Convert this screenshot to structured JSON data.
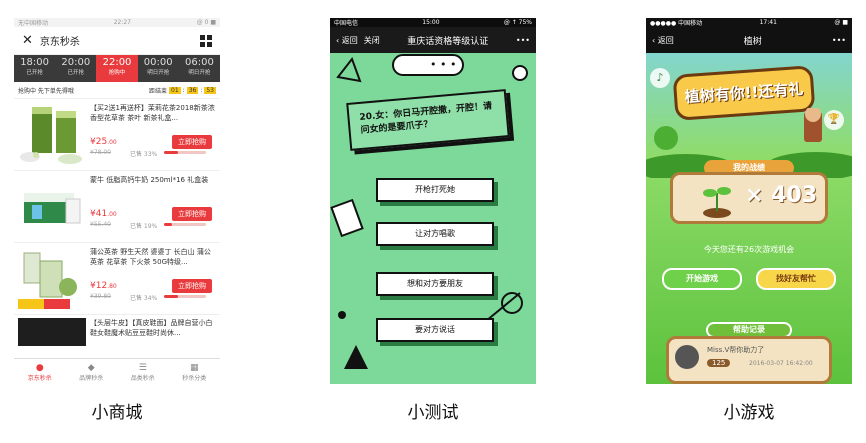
{
  "captions": [
    "小商城",
    "小测试",
    "小游戏"
  ],
  "shop": {
    "status_left": "无中国移动 ",
    "status_time": "22:27",
    "status_right": "@ 0 ■",
    "title": "京东秒杀",
    "time_slots": [
      {
        "time": "18:00",
        "status": "已开抢"
      },
      {
        "time": "20:00",
        "status": "已开抢"
      },
      {
        "time": "22:00",
        "status": "抢购中"
      },
      {
        "time": "00:00",
        "status": "明日开抢"
      },
      {
        "time": "06:00",
        "status": "明日开抢"
      }
    ],
    "subbar_left": "抢购中 先下单先得哦",
    "countdown_label": "距结束",
    "countdown": [
      "01",
      "36",
      "53"
    ],
    "products": [
      {
        "title": "【买2送1再送杯】茉莉花茶2018新茶浓香型花草茶 茶叶 新茶礼盒...",
        "price": "25",
        "price_dec": ".00",
        "old": "¥78.00",
        "sold": "已售 33%",
        "sold_pct": 33,
        "button": "立即抢购"
      },
      {
        "title": "蒙牛 低脂高钙牛奶 250ml*16 礼盒装",
        "price": "41",
        "price_dec": ".00",
        "old": "¥55.40",
        "sold": "已售 19%",
        "sold_pct": 19,
        "button": "立即抢购"
      },
      {
        "title": "蒲公英茶 野生天然 婆婆丁 长白山 蒲公英茶 花草茶 下火茶 50G特级...",
        "price": "12",
        "price_dec": ".80",
        "old": "¥39.80",
        "sold": "已售 34%",
        "sold_pct": 34,
        "button": "立即抢购"
      },
      {
        "title": "【头层牛皮】【真皮鞋面】品牌自营小白鞋女鞋魔术贴豆豆鞋时尚休..."
      }
    ],
    "tabs": [
      "京东秒杀",
      "品牌秒杀",
      "品类秒杀",
      "秒杀分类"
    ],
    "colors": {
      "accent": "#e93b3d"
    }
  },
  "quiz": {
    "status_left": "中国电信 ",
    "status_time": "15:00",
    "status_right": "@ ↑ 75%",
    "back": "返回",
    "close": "关闭",
    "title": "重庆话资格等级认证",
    "more": "•••",
    "question": "20.女：你日马开腔撒，开腔！请问女的是要爪子？",
    "options": [
      "开枪打死她",
      "让对方唱歌",
      "想和对方要朋友",
      "要对方说话"
    ]
  },
  "game": {
    "status_left": "●●●●● 中国移动 ",
    "status_time": "17:41",
    "status_right": "@ ■",
    "back": "返回",
    "title": "植树",
    "more": "•••",
    "banner": "植树有你!!还有礼",
    "record_label": "我的战绩",
    "score": "× 403",
    "chances": "今天您还有26次游戏机会",
    "start_button": "开始游戏",
    "help_button": "找好友帮忙",
    "help_log_label": "帮助记录",
    "log_entry": {
      "text": "Miss.V帮你助力了",
      "amount": "125",
      "time": "2016-03-07 16:42:00"
    }
  }
}
